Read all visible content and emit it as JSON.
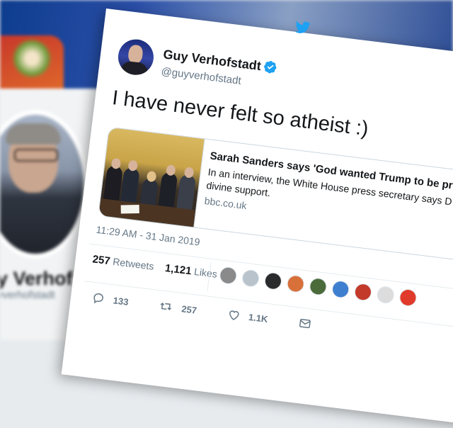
{
  "background": {
    "profile_name": "y Verhof",
    "profile_handle": "yverhofstadt"
  },
  "tweet": {
    "author_name": "Guy Verhofstadt",
    "author_handle": "@guyverhofstadt",
    "text": "I have never felt so atheist :)",
    "timestamp": "11:29 AM - 31 Jan 2019",
    "link_card": {
      "title": "Sarah Sanders says 'God wanted Trump to be pres",
      "description": "In an interview, the White House press secretary says D Trump had divine support.",
      "domain": "bbc.co.uk"
    },
    "stats": {
      "retweets_count": "257",
      "retweets_label": "Retweets",
      "likes_count": "1,121",
      "likes_label": "Likes"
    },
    "liker_avatar_colors": [
      "#8a8a8a",
      "#b9c3cc",
      "#2b2b2b",
      "#d8703a",
      "#4b6b3a",
      "#3f7fd0",
      "#c43a2a",
      "#dcdcdc",
      "#e03a2a"
    ],
    "actions": {
      "replies": "133",
      "retweets": "257",
      "likes": "1.1K"
    },
    "colors": {
      "twitter_blue": "#1da1f2",
      "secondary_text": "#657786"
    }
  }
}
